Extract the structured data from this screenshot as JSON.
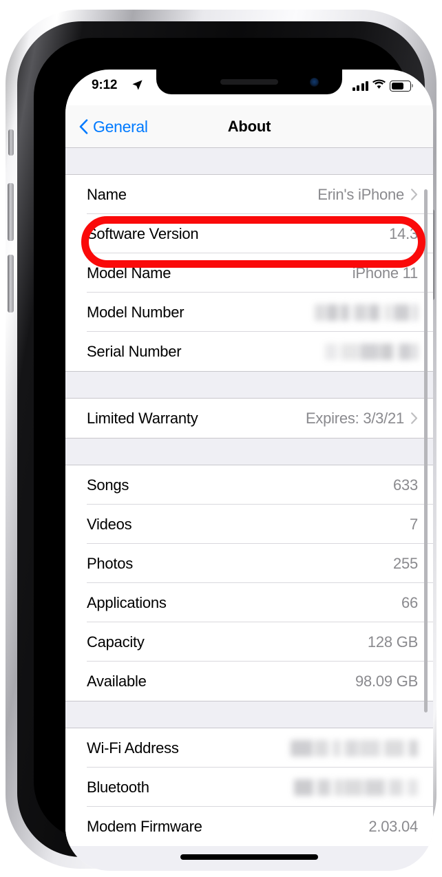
{
  "device": {
    "model": "iPhone 11",
    "frame_color": "#d8d8dc",
    "notch": {
      "speaker_icon": "earpiece-speaker",
      "camera_icon": "front-camera"
    }
  },
  "status_bar": {
    "time": "9:12",
    "location_icon": "location-arrow-icon",
    "signal_icon": "cellular-signal-icon",
    "signal_bars": 4,
    "wifi_icon": "wifi-icon",
    "battery_icon": "battery-icon",
    "battery_level_percent": 62
  },
  "nav": {
    "back_icon": "chevron-left-icon",
    "back_label": "General",
    "title": "About"
  },
  "annotation": {
    "type": "oval-highlight",
    "color": "#fa0a0a",
    "targets_row": "Name"
  },
  "accent_color": "#007aff",
  "value_color": "#8a8a8e",
  "sections": [
    {
      "name": "device-info",
      "rows": [
        {
          "label": "Name",
          "value": "Erin's iPhone",
          "chevron": true,
          "redacted": false,
          "highlighted": true
        },
        {
          "label": "Software Version",
          "value": "14.3",
          "chevron": false,
          "redacted": false
        },
        {
          "label": "Model Name",
          "value": "iPhone 11",
          "chevron": false,
          "redacted": false
        },
        {
          "label": "Model Number",
          "value": "",
          "chevron": false,
          "redacted": true,
          "redacted_width": 150
        },
        {
          "label": "Serial Number",
          "value": "",
          "chevron": false,
          "redacted": true,
          "redacted_width": 135
        }
      ]
    },
    {
      "name": "warranty",
      "rows": [
        {
          "label": "Limited Warranty",
          "value": "Expires: 3/3/21",
          "chevron": true,
          "redacted": false
        }
      ]
    },
    {
      "name": "storage-and-media",
      "rows": [
        {
          "label": "Songs",
          "value": "633",
          "chevron": false,
          "redacted": false
        },
        {
          "label": "Videos",
          "value": "7",
          "chevron": false,
          "redacted": false
        },
        {
          "label": "Photos",
          "value": "255",
          "chevron": false,
          "redacted": false
        },
        {
          "label": "Applications",
          "value": "66",
          "chevron": false,
          "redacted": false
        },
        {
          "label": "Capacity",
          "value": "128 GB",
          "chevron": false,
          "redacted": false
        },
        {
          "label": "Available",
          "value": "98.09 GB",
          "chevron": false,
          "redacted": false
        }
      ]
    },
    {
      "name": "network-addresses",
      "rows": [
        {
          "label": "Wi-Fi Address",
          "value": "",
          "chevron": false,
          "redacted": true,
          "redacted_width": 185
        },
        {
          "label": "Bluetooth",
          "value": "",
          "chevron": false,
          "redacted": true,
          "redacted_width": 180
        },
        {
          "label": "Modem Firmware",
          "value": "2.03.04",
          "chevron": false,
          "redacted": false
        }
      ]
    }
  ],
  "home_indicator": "home-indicator-bar"
}
